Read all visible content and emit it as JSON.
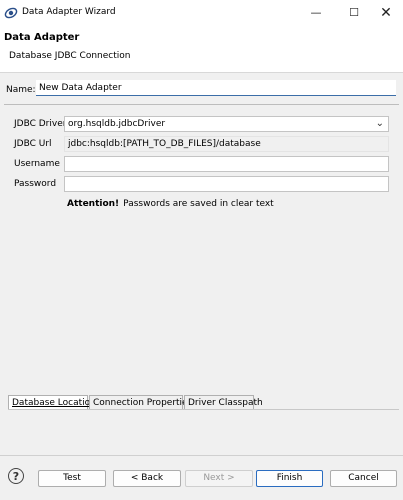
{
  "window": {
    "title": "Data Adapter Wizard",
    "controls": {
      "minimize": "—",
      "maximize": "☐",
      "close": "✕"
    }
  },
  "header": {
    "title": "Data Adapter",
    "subtitle": "Database JDBC Connection"
  },
  "name": {
    "label": "Name:",
    "value": "New Data Adapter"
  },
  "form": {
    "driver": {
      "label": "JDBC Driver",
      "value": "org.hsqldb.jdbcDriver"
    },
    "url": {
      "label": "JDBC Url",
      "value": "jdbc:hsqldb:[PATH_TO_DB_FILES]/database"
    },
    "username": {
      "label": "Username",
      "value": ""
    },
    "password": {
      "label": "Password",
      "value": ""
    }
  },
  "attention": {
    "strong": "Attention!",
    "text": "Passwords are saved in clear text"
  },
  "tabs": [
    {
      "label": "Database Location",
      "active": true
    },
    {
      "label": "Connection Properties",
      "active": false
    },
    {
      "label": "Driver Classpath",
      "active": false
    }
  ],
  "buttons": {
    "help": "?",
    "test": "Test",
    "back": "< Back",
    "next": "Next >",
    "finish": "Finish",
    "cancel": "Cancel"
  },
  "colors": {
    "accent": "#2a6cc0",
    "background": "#f0f0f0"
  }
}
